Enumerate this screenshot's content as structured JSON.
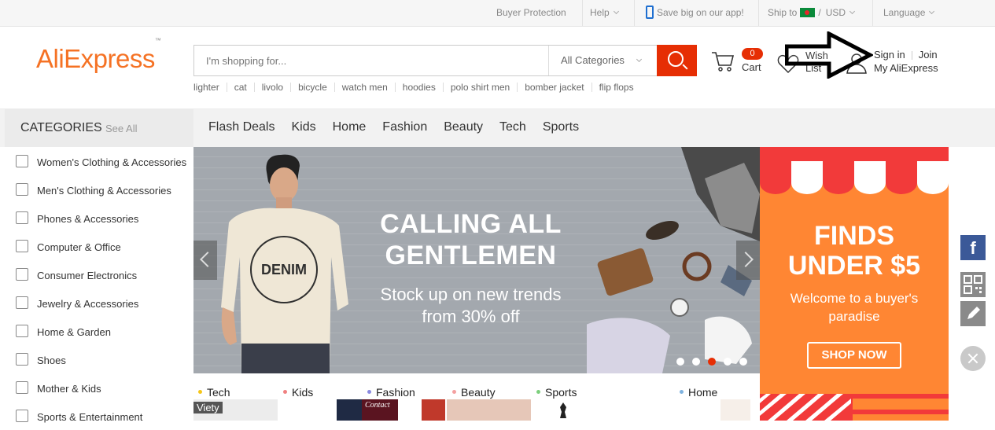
{
  "topbar": {
    "buyer_protection": "Buyer Protection",
    "help": "Help",
    "app_promo": "Save big on our app!",
    "ship_to": "Ship to",
    "slash": "/",
    "currency": "USD",
    "language": "Language"
  },
  "header": {
    "logo": "AliExpress",
    "logo_tm": "™",
    "search_placeholder": "I'm shopping for...",
    "category_select": "All Categories",
    "hot_keywords": [
      "lighter",
      "cat",
      "livolo",
      "bicycle",
      "watch men",
      "hoodies",
      "polo shirt men",
      "bomber jacket",
      "flip flops"
    ],
    "cart_count": "0",
    "cart_label": "Cart",
    "wish_label_1": "Wish",
    "wish_label_2": "List",
    "sign_in": "Sign in",
    "join": "Join",
    "my_aliexpress": "My AliExpress"
  },
  "nav": {
    "categories_title": "CATEGORIES",
    "see_all": "See All",
    "links": [
      "Flash Deals",
      "Kids",
      "Home",
      "Fashion",
      "Beauty",
      "Tech",
      "Sports"
    ]
  },
  "categories": [
    {
      "label": "Women's Clothing & Accessories",
      "icon": "dress-icon"
    },
    {
      "label": "Men's Clothing & Accessories",
      "icon": "shirt-icon"
    },
    {
      "label": "Phones & Accessories",
      "icon": "phone-icon"
    },
    {
      "label": "Computer & Office",
      "icon": "laptop-icon"
    },
    {
      "label": "Consumer Electronics",
      "icon": "camera-icon"
    },
    {
      "label": "Jewelry & Accessories",
      "icon": "ring-icon"
    },
    {
      "label": "Home & Garden",
      "icon": "sofa-icon"
    },
    {
      "label": "Shoes",
      "icon": "shoe-icon"
    },
    {
      "label": "Mother & Kids",
      "icon": "baby-icon"
    },
    {
      "label": "Sports & Entertainment",
      "icon": "ball-icon"
    }
  ],
  "banner": {
    "headline_1": "CALLING ALL",
    "headline_2": "GENTLEMEN",
    "sub_1": "Stock up on new trends",
    "sub_2": "from 30% off",
    "shirt_text": "DENIM",
    "active_dot": 3,
    "dot_count": 5
  },
  "promo": {
    "title_1": "FINDS",
    "title_2": "UNDER $5",
    "sub_1": "Welcome to a buyer's",
    "sub_2": "paradise",
    "button": "SHOP NOW"
  },
  "bottom_categories": [
    {
      "label": "Tech",
      "color": "#f5c518"
    },
    {
      "label": "Kids",
      "color": "#f08080"
    },
    {
      "label": "Fashion",
      "color": "#8a8ae0"
    },
    {
      "label": "Beauty",
      "color": "#f4a0a0"
    },
    {
      "label": "Sports",
      "color": "#7ccf7c"
    },
    {
      "label": "Home",
      "color": "#7fb3e0"
    }
  ],
  "bottom_thumb_text": {
    "viety": "Viety",
    "contact": "Contact"
  },
  "side_tools": {
    "facebook": "f"
  },
  "colors": {
    "accent": "#e62e04",
    "brand": "#f57224",
    "promo": "#ff8633"
  }
}
